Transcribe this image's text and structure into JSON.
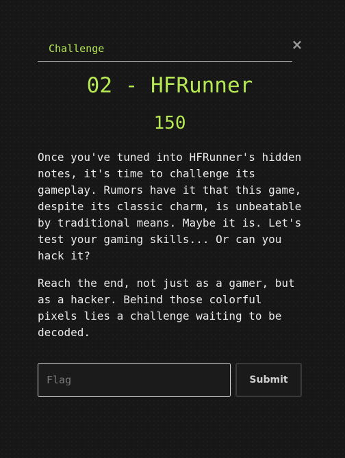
{
  "modal": {
    "close_glyph": "×",
    "tab_label": "Challenge",
    "title": "02 - HFRunner",
    "value": "150",
    "description": [
      "Once you've tuned into HFRunner's hidden\nnotes, it's time to challenge its\ngameplay. Rumors have it that this game,\ndespite its classic charm, is unbeatable\nby traditional means. Maybe it is. Let's\ntest your gaming skills... Or can you\nhack it?",
      "Reach the end, not just as a gamer, but\nas a hacker. Behind those colorful\npixels lies a challenge waiting to be\ndecoded."
    ],
    "flag_placeholder": "Flag",
    "flag_value": "",
    "submit_label": "Submit"
  },
  "colors": {
    "accent": "#b5e853",
    "background": "#171717",
    "text": "#eaeaea"
  },
  "icons": {
    "close": "close-icon"
  }
}
